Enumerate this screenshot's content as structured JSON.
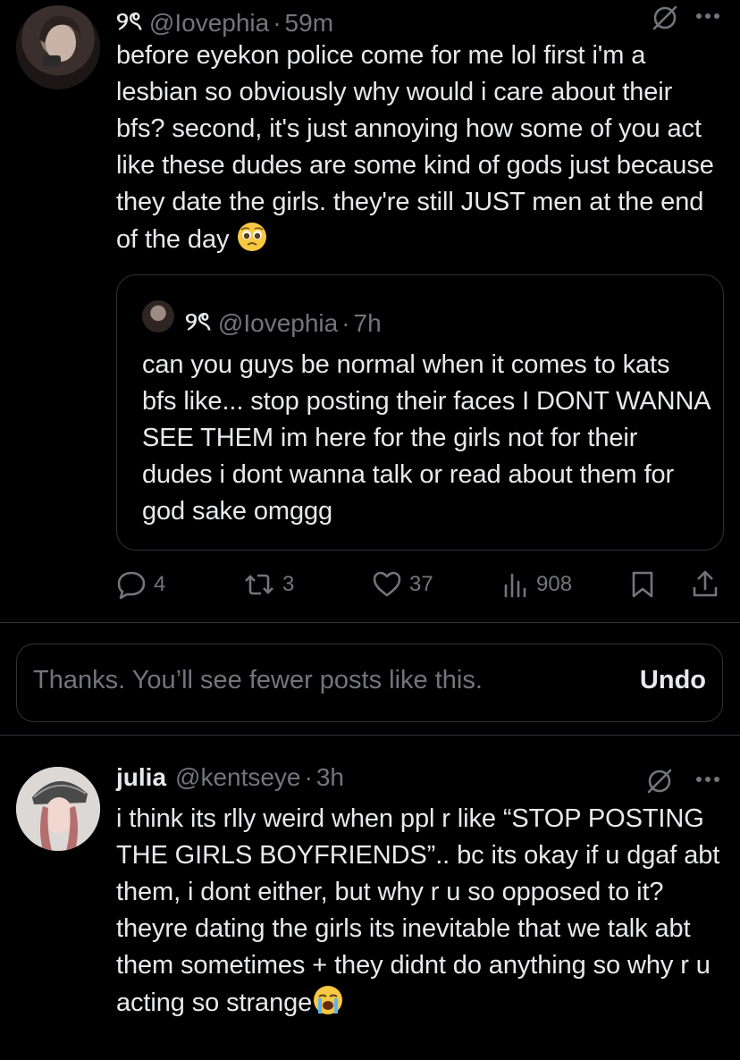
{
  "post1": {
    "display_name": "୨ৎ",
    "handle": "@Iovephia",
    "dot": "·",
    "time": "59m",
    "text": "before eyekon police come for me lol first i'm a lesbian so obviously why would i care about their bfs? second, it's just annoying how some of you act like these dudes are some kind of gods just because they date the girls. they're still JUST men at the end of the day",
    "emoji": "pleading-face",
    "quote": {
      "display_name": "୨ৎ",
      "handle": "@Iovephia",
      "dot": "·",
      "time": "7h",
      "text": "can you guys be normal when it comes to kats bfs like... stop posting their faces I DONT WANNA SEE THEM im here for the girls not for their dudes i dont wanna talk or read about them for god sake omggg"
    },
    "actions": {
      "replies": "4",
      "reposts": "3",
      "likes": "37",
      "views": "908"
    }
  },
  "notice": {
    "text": "Thanks. You’ll see fewer posts like this.",
    "undo": "Undo"
  },
  "post2": {
    "display_name": "julia",
    "handle": "@kentseye",
    "dot": "·",
    "time": "3h",
    "text": "i think its rlly weird when ppl r like “STOP POSTING THE GIRLS BOYFRIENDS”.. bc its okay if u dgaf abt them, i dont either, but why r u so opposed to it? theyre dating the girls its inevitable that we talk abt them sometimes + they didnt do anything so why r u acting so strange",
    "emoji": "loudly-crying-face"
  },
  "colors": {
    "background": "#000000",
    "text_primary": "#e7e9ea",
    "text_secondary": "#71767b",
    "border": "#2f3336"
  }
}
